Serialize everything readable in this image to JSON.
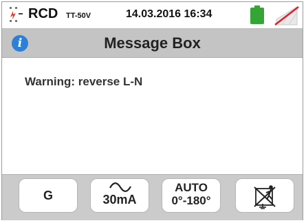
{
  "status": {
    "mode": "RCD",
    "mode_sub": "TT-50V",
    "datetime": "14.03.2016  16:34",
    "battery_icon": "battery-full-icon",
    "signal_icon": "wireless-off-icon",
    "battery_color": "#35a535",
    "signal_strike_color": "#d9232e"
  },
  "titlebar": {
    "icon": "info-icon",
    "info_glyph": "i",
    "title": "Message Box"
  },
  "message": "Warning: reverse L-N",
  "footer": {
    "keys": [
      {
        "label": "G"
      },
      {
        "icon": "sine-wave-icon",
        "label": "30mA"
      },
      {
        "line1": "AUTO",
        "line2": "0°-180°"
      },
      {
        "icon": "touch-contact-disabled-icon"
      }
    ]
  },
  "colors": {
    "titlebar_bg": "#c4c4c4",
    "footer_bg": "#cbcbcb",
    "info_blue": "#2e7fd6"
  }
}
